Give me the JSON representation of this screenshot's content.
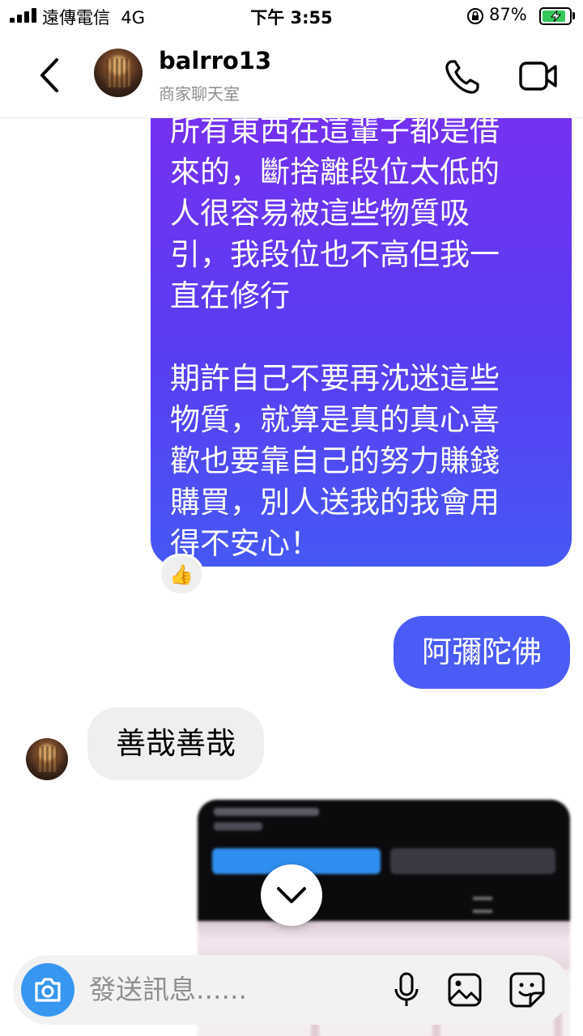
{
  "status_bar": {
    "carrier": "遠傳電信",
    "network": "4G",
    "time": "下午 3:55",
    "battery_percent": "87%",
    "battery_level": 0.87
  },
  "header": {
    "username": "balrro13",
    "subtitle": "商家聊天室",
    "icons": [
      "back-chevron",
      "avatar",
      "phone",
      "video-camera"
    ]
  },
  "messages": [
    {
      "direction": "outgoing",
      "text": "所有東西在這輩子都是借\n來的，斷捨離段位太低的\n人很容易被這些物質吸\n引，我段位也不高但我一\n直在修行\n\n期許自己不要再沈迷這些\n物質，就算是真的真心喜\n歡也要靠自己的努力賺錢\n購買，別人送我的我會用\n得不安心！",
      "reaction": "👍"
    },
    {
      "direction": "outgoing",
      "text": "阿彌陀佛"
    },
    {
      "direction": "incoming",
      "text": "善哉善哉"
    },
    {
      "direction": "outgoing",
      "type": "image"
    }
  ],
  "composer": {
    "placeholder": "發送訊息......",
    "icons": [
      "camera",
      "microphone",
      "gallery",
      "sticker"
    ]
  },
  "colors": {
    "outgoing_gradient_top": "#7a2ff0",
    "outgoing_gradient_bottom": "#4658f4",
    "outgoing_solid": "#4a5cf5",
    "incoming": "#efefef",
    "camera_button": "#3797f0"
  }
}
